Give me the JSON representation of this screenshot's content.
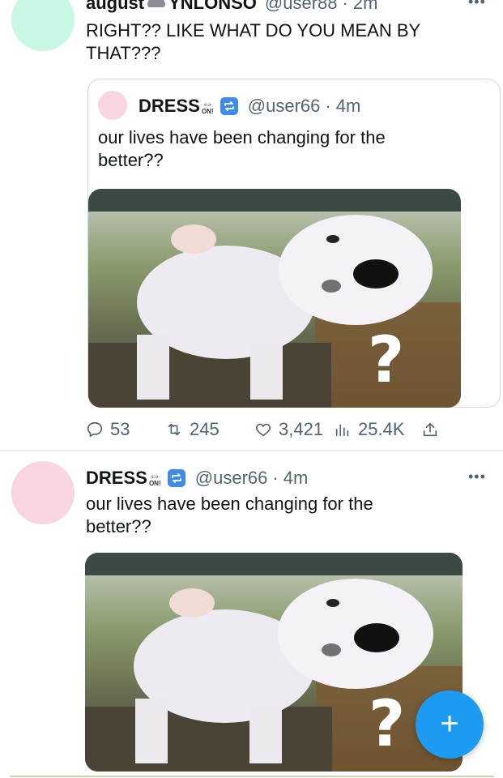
{
  "colors": {
    "accent": "#1d9bf0",
    "avatar_mint": "#c8f7e4",
    "avatar_pink": "#f8d5e0",
    "secondary_text": "#536471"
  },
  "tweet1": {
    "display_name": "august",
    "display_name_suffix": "YNLONSO",
    "handle": "@user88",
    "time": "2m",
    "text": "RIGHT?? LIKE WHAT DO YOU MEAN BY THAT???",
    "more_icon": "more-icon",
    "quote": {
      "display_name": "DRESS",
      "emoji_on_arrow": "⇔",
      "emoji_on_label": "ON!",
      "emoji_repeat": "repeat-emoji",
      "handle": "@user66",
      "time": "4m",
      "text": "our lives have been changing for the better??",
      "image_question_mark": "?"
    },
    "actions": {
      "replies": "53",
      "retweets": "245",
      "likes": "3,421",
      "views": "25.4K",
      "icons": [
        "reply-icon",
        "retweet-icon",
        "like-icon",
        "views-icon",
        "share-icon"
      ]
    }
  },
  "tweet2": {
    "display_name": "DRESS",
    "emoji_on_arrow": "⇔",
    "emoji_on_label": "ON!",
    "handle": "@user66",
    "time": "4m",
    "more_label": "•••",
    "text": "our lives have been changing for the better??",
    "image_question_mark": "?"
  },
  "compose": {
    "label": "+",
    "icon": "plus-icon"
  },
  "separator": "·"
}
